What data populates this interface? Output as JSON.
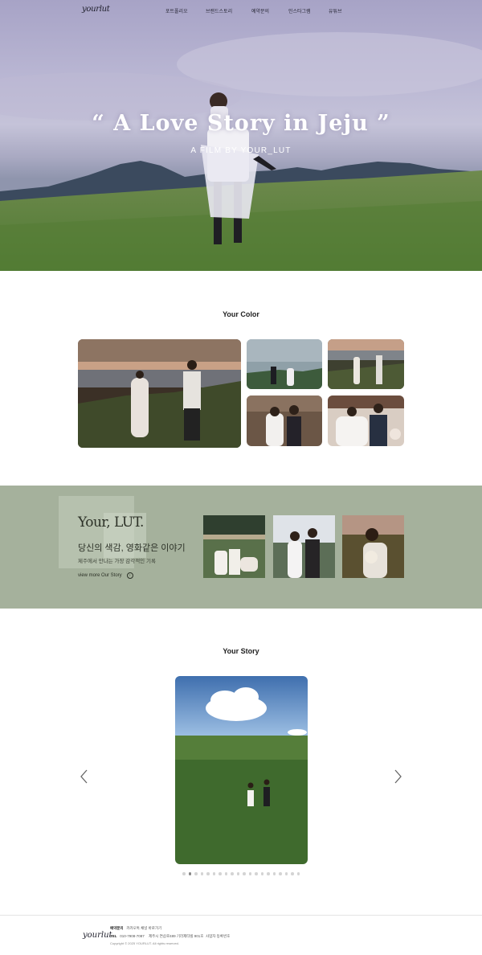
{
  "brand": {
    "logo_text": "yourlut"
  },
  "nav": {
    "items": [
      "포트폴리오",
      "브랜드스토리",
      "예약문의",
      "인스타그램",
      "유튜브"
    ]
  },
  "hero": {
    "title": "“ A Love Story in Jeju ”",
    "subtitle": "A FILM BY YOUR_LUT"
  },
  "color_section": {
    "title": "Your Color"
  },
  "lut_section": {
    "heading": "Your, LUT.",
    "tagline": "당신의 색감, 영화같은 이야기",
    "description": "제주에서 만나는 가장 감각적인 기록",
    "link_label": "view more Our Story"
  },
  "story_section": {
    "title": "Your Story",
    "slide_count": 20,
    "active_slide": 1
  },
  "footer": {
    "contact_label": "예약문의",
    "contact_text": "카카오톡 채널 바로가기",
    "tel_label": "TEL",
    "tel_value": "010-7908-7087",
    "address": "제주시 연삼로489 기라제타빌 901호",
    "biz_info": "사업자 등록번호",
    "copyright": "Copyright © 2025 YOURLUT. All rights reserved."
  },
  "colors": {
    "lut_band": "#a5b19c",
    "hero_sky": "#b9b6d3",
    "accent_dark": "#2c3127"
  }
}
